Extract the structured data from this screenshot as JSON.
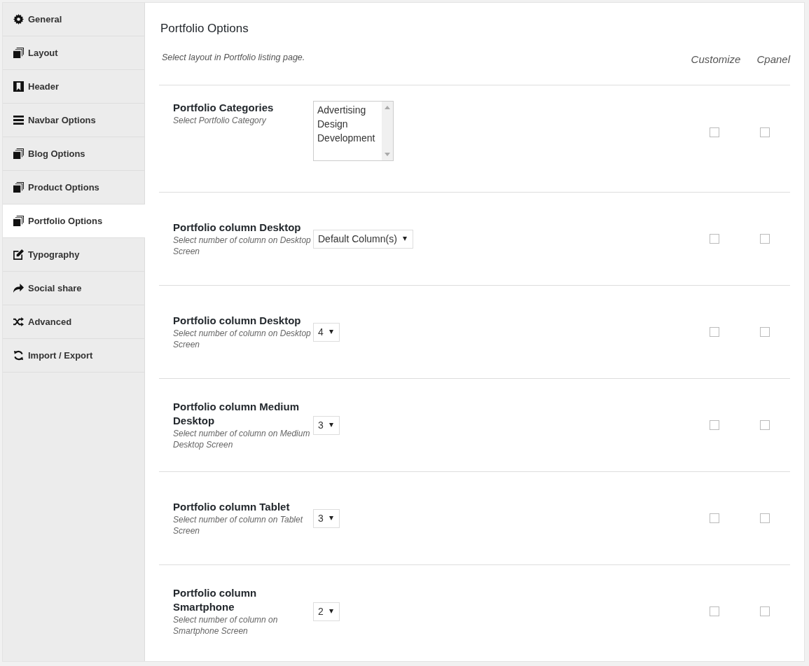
{
  "sidebar": {
    "items": [
      {
        "label": "General",
        "selected": false
      },
      {
        "label": "Layout",
        "selected": false
      },
      {
        "label": "Header",
        "selected": false
      },
      {
        "label": "Navbar Options",
        "selected": false
      },
      {
        "label": "Blog Options",
        "selected": false
      },
      {
        "label": "Product Options",
        "selected": false
      },
      {
        "label": "Portfolio Options",
        "selected": true
      },
      {
        "label": "Typography",
        "selected": false
      },
      {
        "label": "Social share",
        "selected": false
      },
      {
        "label": "Advanced",
        "selected": false
      },
      {
        "label": "Import / Export",
        "selected": false
      }
    ]
  },
  "section": {
    "title": "Portfolio Options",
    "description": "Select layout in Portfolio listing page.",
    "column_headers": [
      "Customize",
      "Cpanel"
    ]
  },
  "options": [
    {
      "title": "Portfolio Categories",
      "description": "Select Portfolio Category",
      "kind": "multiselect",
      "options": [
        "Advertising",
        "Design",
        "Development"
      ],
      "customize": {
        "checked": false
      },
      "cpanel": {
        "checked": false
      }
    },
    {
      "title": "Portfolio column Desktop",
      "description": "Select number of column on Desktop Screen",
      "kind": "select",
      "value": "Default Column(s)",
      "customize": {
        "checked": false
      },
      "cpanel": {
        "checked": false
      }
    },
    {
      "title": "Portfolio column Desktop",
      "description": "Select number of column on Desktop Screen",
      "kind": "select",
      "value": "4",
      "customize": {
        "checked": false
      },
      "cpanel": {
        "checked": false
      }
    },
    {
      "title": "Portfolio column Medium Desktop",
      "description": "Select number of column on Medium Desktop Screen",
      "kind": "select",
      "value": "3",
      "customize": {
        "checked": false
      },
      "cpanel": {
        "checked": false
      }
    },
    {
      "title": "Portfolio column Tablet",
      "description": "Select number of column on Tablet Screen",
      "kind": "select",
      "value": "3",
      "customize": {
        "checked": false
      },
      "cpanel": {
        "checked": false
      }
    },
    {
      "title": "Portfolio column Smartphone",
      "description": "Select number of column on Smartphone Screen",
      "kind": "select",
      "value": "2",
      "customize": {
        "checked": false
      },
      "cpanel": {
        "checked": false
      }
    }
  ]
}
